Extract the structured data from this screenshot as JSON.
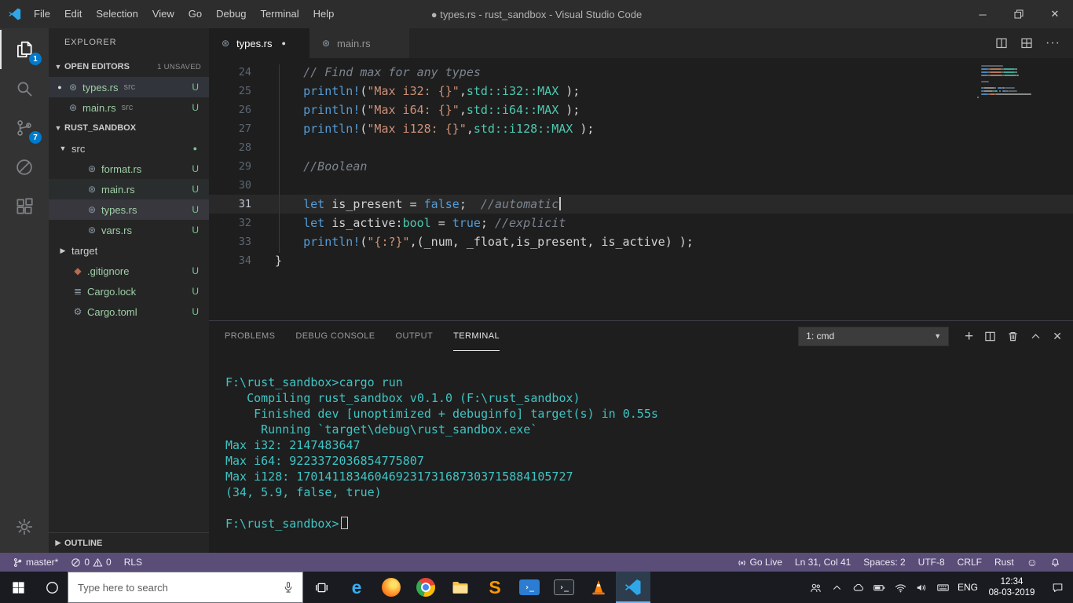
{
  "colors": {
    "accent": "#007acc",
    "statusbar": "#5a4d78",
    "untracked": "#73c991",
    "terminal_fg": "#40c4c4",
    "keyword": "#569cd6",
    "string": "#ce9178",
    "type": "#4ec9b0",
    "comment": "#7d8590"
  },
  "titlebar": {
    "menus": [
      "File",
      "Edit",
      "Selection",
      "View",
      "Go",
      "Debug",
      "Terminal",
      "Help"
    ],
    "title": "● types.rs - rust_sandbox - Visual Studio Code"
  },
  "activity_bar": {
    "items": [
      {
        "name": "explorer",
        "badge": "1",
        "active": true
      },
      {
        "name": "search"
      },
      {
        "name": "source-control",
        "badge": "7"
      },
      {
        "name": "debug"
      },
      {
        "name": "extensions"
      }
    ]
  },
  "sidebar": {
    "title": "EXPLORER",
    "open_editors": {
      "label": "OPEN EDITORS",
      "badge": "1 UNSAVED",
      "items": [
        {
          "name": "types.rs",
          "detail": "src",
          "dirty": true,
          "git": "U",
          "active": true
        },
        {
          "name": "main.rs",
          "detail": "src",
          "dirty": false,
          "git": "U"
        }
      ]
    },
    "workspace": {
      "label": "RUST_SANDBOX",
      "items": [
        {
          "name": "src",
          "kind": "folder",
          "expanded": true,
          "indent": 0,
          "dot": true
        },
        {
          "name": "format.rs",
          "kind": "rust",
          "indent": 1,
          "git": "U"
        },
        {
          "name": "main.rs",
          "kind": "rust",
          "indent": 1,
          "git": "U",
          "hover": true
        },
        {
          "name": "types.rs",
          "kind": "rust",
          "indent": 1,
          "git": "U",
          "selected": true
        },
        {
          "name": "vars.rs",
          "kind": "rust",
          "indent": 1,
          "git": "U"
        },
        {
          "name": "target",
          "kind": "folder",
          "expanded": false,
          "indent": 0
        },
        {
          "name": ".gitignore",
          "kind": "git",
          "indent": 0,
          "git": "U"
        },
        {
          "name": "Cargo.lock",
          "kind": "lock",
          "indent": 0,
          "git": "U"
        },
        {
          "name": "Cargo.toml",
          "kind": "toml",
          "indent": 0,
          "git": "U"
        }
      ]
    },
    "outline_label": "OUTLINE"
  },
  "editor": {
    "tabs": [
      {
        "name": "types.rs",
        "active": true,
        "dirty": true
      },
      {
        "name": "main.rs",
        "active": false,
        "dirty": false
      }
    ],
    "lines": [
      {
        "num": "24",
        "tokens": [
          [
            "    ",
            "p"
          ],
          [
            "// Find max for any types",
            "c"
          ]
        ]
      },
      {
        "num": "25",
        "tokens": [
          [
            "    ",
            "p"
          ],
          [
            "println!",
            "k"
          ],
          [
            "(",
            "p"
          ],
          [
            "\"Max i32: {}\"",
            "s"
          ],
          [
            ",",
            "p"
          ],
          [
            "std::i32::MAX",
            "t"
          ],
          [
            " );",
            "p"
          ]
        ]
      },
      {
        "num": "26",
        "tokens": [
          [
            "    ",
            "p"
          ],
          [
            "println!",
            "k"
          ],
          [
            "(",
            "p"
          ],
          [
            "\"Max i64: {}\"",
            "s"
          ],
          [
            ",",
            "p"
          ],
          [
            "std::i64::MAX",
            "t"
          ],
          [
            " );",
            "p"
          ]
        ]
      },
      {
        "num": "27",
        "tokens": [
          [
            "    ",
            "p"
          ],
          [
            "println!",
            "k"
          ],
          [
            "(",
            "p"
          ],
          [
            "\"Max i128: {}\"",
            "s"
          ],
          [
            ",",
            "p"
          ],
          [
            "std::i128::MAX",
            "t"
          ],
          [
            " );",
            "p"
          ]
        ]
      },
      {
        "num": "28",
        "tokens": []
      },
      {
        "num": "29",
        "tokens": [
          [
            "    ",
            "p"
          ],
          [
            "//Boolean",
            "c"
          ]
        ]
      },
      {
        "num": "30",
        "tokens": []
      },
      {
        "num": "31",
        "current": true,
        "tokens": [
          [
            "    ",
            "p"
          ],
          [
            "let",
            "k"
          ],
          [
            " is_present ",
            "p"
          ],
          [
            "=",
            "p"
          ],
          [
            " ",
            "p"
          ],
          [
            "false",
            "k"
          ],
          [
            ";  ",
            "p"
          ],
          [
            "//automatic",
            "c"
          ]
        ]
      },
      {
        "num": "32",
        "tokens": [
          [
            "    ",
            "p"
          ],
          [
            "let",
            "k"
          ],
          [
            " is_active",
            "p"
          ],
          [
            ":",
            "p"
          ],
          [
            "bool",
            "t"
          ],
          [
            " ",
            "p"
          ],
          [
            "=",
            "p"
          ],
          [
            " ",
            "p"
          ],
          [
            "true",
            "k"
          ],
          [
            "; ",
            "p"
          ],
          [
            "//explicit",
            "c"
          ]
        ]
      },
      {
        "num": "33",
        "tokens": [
          [
            "    ",
            "p"
          ],
          [
            "println!",
            "k"
          ],
          [
            "(",
            "p"
          ],
          [
            "\"{:?}\"",
            "s"
          ],
          [
            ",(_num, _float,is_present, is_active) );",
            "p"
          ]
        ]
      },
      {
        "num": "34",
        "tokens": [
          [
            "}",
            "p"
          ]
        ]
      }
    ]
  },
  "panel": {
    "tabs": [
      {
        "label": "PROBLEMS"
      },
      {
        "label": "DEBUG CONSOLE"
      },
      {
        "label": "OUTPUT"
      },
      {
        "label": "TERMINAL",
        "active": true
      }
    ],
    "terminal_select": "1: cmd",
    "terminal_lines": [
      "F:\\rust_sandbox>cargo run",
      "   Compiling rust_sandbox v0.1.0 (F:\\rust_sandbox)",
      "    Finished dev [unoptimized + debuginfo] target(s) in 0.55s",
      "     Running `target\\debug\\rust_sandbox.exe`",
      "Max i32: 2147483647",
      "Max i64: 9223372036854775807",
      "Max i128: 170141183460469231731687303715884105727",
      "(34, 5.9, false, true)",
      "",
      "F:\\rust_sandbox>"
    ]
  },
  "status_bar": {
    "branch": "master*",
    "errors": "0",
    "warnings": "0",
    "rls": "RLS",
    "go_live": "Go Live",
    "cursor": "Ln 31, Col 41",
    "indent": "Spaces: 2",
    "encoding": "UTF-8",
    "eol": "CRLF",
    "language": "Rust"
  },
  "taskbar": {
    "search_placeholder": "Type here to search",
    "apps": [
      "edge",
      "firefox",
      "chrome",
      "explorer",
      "sublime",
      "powershell",
      "cmd",
      "vlc",
      "vscode"
    ],
    "active_app": "vscode",
    "language": "ENG",
    "time": "12:34",
    "date": "08-03-2019"
  }
}
